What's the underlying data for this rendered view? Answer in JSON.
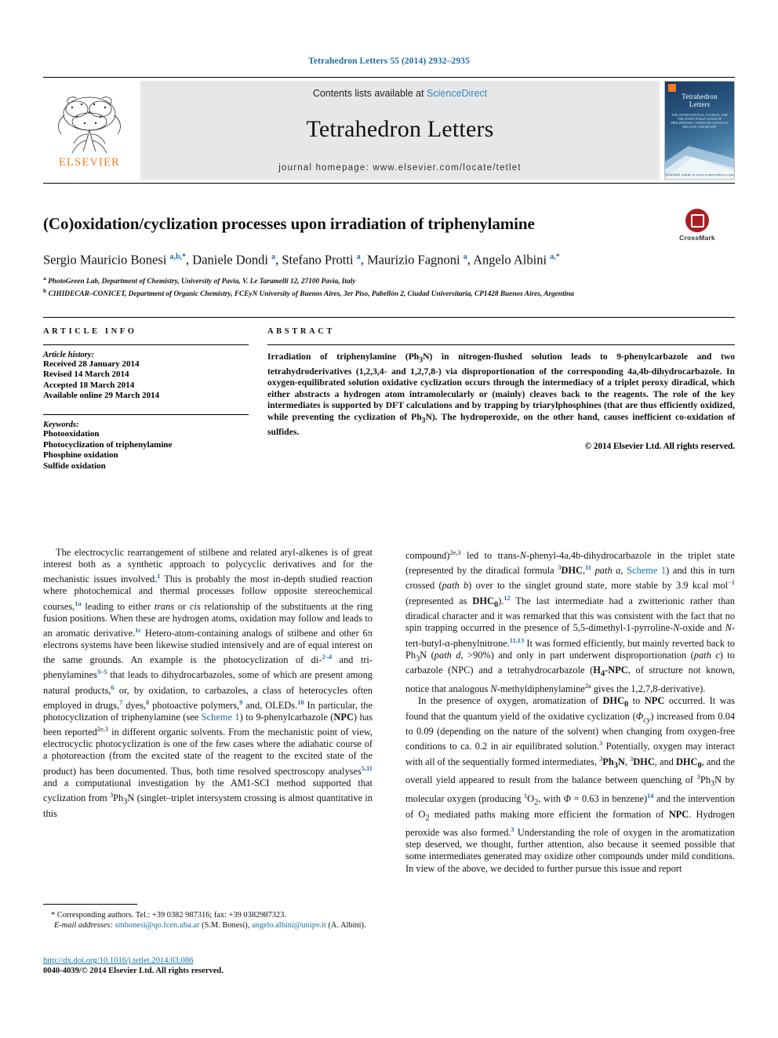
{
  "running_head": "Tetrahedron Letters 55 (2014) 2932–2935",
  "masthead": {
    "contents_prefix": "Contents lists available at ",
    "sciencedirect": "ScienceDirect",
    "journal_name": "Tetrahedron Letters",
    "homepage": "journal homepage: www.elsevier.com/locate/tetlet",
    "publisher": "ELSEVIER",
    "cover": {
      "title_line1": "Tetrahedron",
      "title_line2": "Letters",
      "subtitle": "THE INTERNATIONAL JOURNAL FOR THE RAPID PUBLICATION OF PRELIMINARY COMMUNICATIONS IN ORGANIC CHEMISTRY",
      "footer": "Available online at www.sciencedirect.com"
    }
  },
  "article": {
    "title": "(Co)oxidation/cyclization processes upon irradiation of triphenylamine",
    "crossmark_label": "CrossMark",
    "authors_html": "Sergio Mauricio Bonesi <sup>a,b,</sup><sup>*</sup>, Daniele Dondi <sup>a</sup>, Stefano Protti <sup>a</sup>, Maurizio Fagnoni <sup>a</sup>, Angelo Albini <sup>a,</sup><sup>*</sup>",
    "affiliation_a": "PhotoGreen Lab, Department of Chemistry, University of Pavia, V. Le Taramelli 12, 27100 Pavia, Italy",
    "affiliation_b": "CIHIDECAR–CONICET, Department of Organic Chemistry, FCEyN University of Buenos Aires, 3er Piso, Pabellón 2, Ciudad Universitaria, CP1428 Buenos Aires, Argentina"
  },
  "article_info": {
    "heading": "ARTICLE INFO",
    "history_title": "Article history:",
    "history": [
      "Received 28 January 2014",
      "Revised 14 March 2014",
      "Accepted 18 March 2014",
      "Available online 29 March 2014"
    ],
    "keywords_title": "Keywords:",
    "keywords": [
      "Photooxidation",
      "Photocyclization of triphenylamine",
      "Phosphine oxidation",
      "Sulfide oxidation"
    ]
  },
  "abstract": {
    "heading": "ABSTRACT",
    "text_html": "Irradiation of triphenylamine (Ph<sub>3</sub>N) in nitrogen-flushed solution leads to 9-phenylcarbazole and two tetrahydroderivatives (1,2,3,4- and 1,2,7,8-) via disproportionation of the corresponding 4a,4b-dihydrocarbazole. In oxygen-equilibrated solution oxidative cyclization occurs through the intermediacy of a triplet peroxy diradical, which either abstracts a hydrogen atom intramolecularly or (mainly) cleaves back to the reagents. The role of the key intermediates is supported by DFT calculations and by trapping by triarylphosphines (that are thus efficiently oxidized, while preventing the cyclization of Ph<sub>3</sub>N). The hydroperoxide, on the other hand, causes inefficient co-oxidation of sulfides.",
    "copyright": "© 2014 Elsevier Ltd. All rights reserved."
  },
  "body": {
    "left_paragraph_html": "The electrocyclic rearrangement of stilbene and related aryl-alkenes is of great interest both as a synthetic approach to polycyclic derivatives and for the mechanistic issues involved.<sup class=\"ref\">1</sup> This is probably the most in-depth studied reaction where photochemical and thermal processes follow opposite stereochemical courses,<sup class=\"ref\">1a</sup> leading to either <i>trans</i> or <i>cis</i> relationship of the substituents at the ring fusion positions. When these are hydrogen atoms, oxidation may follow and leads to an aromatic derivative.<sup class=\"ref\">1c</sup> Hetero-atom-containing analogs of stilbene and other 6π electrons systems have been likewise studied intensively and are of equal interest on the same grounds. An example is the photocyclization of di-<sup class=\"ref\">2–4</sup> and tri-phenylamines<sup class=\"ref\">3–5</sup> that leads to dihydrocarbazoles, some of which are present among natural products,<sup class=\"ref\">6</sup> or, by oxidation, to carbazoles, a class of heterocycles often employed in drugs,<sup class=\"ref\">7</sup> dyes,<sup class=\"ref\">8</sup> photoactive polymers,<sup class=\"ref\">9</sup> and, OLEDs.<sup class=\"ref\">10</sup> In particular, the photocyclization of triphenylamine (see <span class=\"lnk\">Scheme 1</span>) to 9-phenylcarbazole (<b>NPC</b>) has been reported<sup>2e,3</sup> in different organic solvents. From the mechanistic point of view, electrocyclic photocyclization is one of the few cases where the adiabatic course of a photoreaction (from the excited state of the reagent to the excited state of the product) has been documented. Thus, both time resolved spectroscopy analyses<sup class=\"ref\">5,11</sup> and a computational investigation by the AM1-SCI method supported that cyclization from <sup>3</sup>Ph<sub>3</sub>N (singlet–triplet intersystem crossing is almost quantitative in this",
    "right_paragraph_1_html": "compound)<sup>2e,3</sup> led to trans-<i>N</i>-phenyl-4a,4b-dihydrocarbazole in the triplet state (represented by the diradical formula <sup>3</sup><b>DHC</b>,<sup class=\"ref\">11</sup> <i>path a</i>, <span class=\"lnk\">Scheme 1</span>) and this in turn crossed (<i>path b</i>) over to the singlet ground state, more stable by 3.9 kcal mol<sup>−1</sup> (represented as <b>DHC<sub>0</sub></b>).<sup class=\"ref\">12</sup> The last intermediate had a zwitterionic rather than diradical character and it was remarked that this was consistent with the fact that no spin trapping occurred in the presence of 5,5-dimethyl-1-pyrroline-<i>N</i>-oxide and <i>N</i>-tert-butyl-α-phenylnitrone.<sup class=\"ref\">11,13</sup> It was formed efficiently, but mainly reverted back to Ph<sub>3</sub>N (<i>path d</i>, >90%) and only in part underwent disproportionation (<i>path c</i>) to carbazole (NPC) and a tetrahydrocarbazole (<b>H<sub>4</sub>-NPC</b>, of structure not known, notice that analogous <i>N</i>-methyldiphenylamine<sup>2a</sup> gives the 1,2,7,8-derivative).",
    "right_paragraph_2_html": "In the presence of oxygen, aromatization of <b>DHC<sub>0</sub></b> to <b>NPC</b> occurred. It was found that the quantum yield of the oxidative cyclization (<i>Φ<sub>cy</sub></i>) increased from 0.04 to 0.09 (depending on the nature of the solvent) when changing from oxygen-free conditions to ca. 0.2 in air equilibrated solution.<sup class=\"ref\">3</sup> Potentially, oxygen may interact with all of the sequentially formed intermediates, <sup>3</sup><b>Ph<sub>3</sub>N</b>, <sup>3</sup><b>DHC</b>, and <b>DHC<sub>0</sub></b>, and the overall yield appeared to result from the balance between quenching of <sup>3</sup>Ph<sub>3</sub>N by molecular oxygen (producing <sup>1</sup>O<sub>2</sub>, with <i>Φ</i> = 0.63 in benzene)<sup class=\"ref\">14</sup> and the intervention of O<sub>2</sub> mediated paths making more efficient the formation of <b>NPC</b>. Hydrogen peroxide was also formed.<sup class=\"ref\">3</sup> Understanding the role of oxygen in the aromatization step deserved, we thought, further attention, also because it seemed possible that some intermediates generated may oxidize other compounds under mild conditions. In view of the above, we decided to further pursue this issue and report"
  },
  "footnotes": {
    "corresponding_html": "* Corresponding authors. Tel.: +39 0382 987316; fax: +39 0382987323.",
    "emails_html": "<i>E-mail addresses:</i> <a>smbonesi@qo.fcen.uba.ar</a> (S.M. Bonesi), <a>angelo.albini@unipv.it</a> (A. Albini).",
    "doi": "http://dx.doi.org/10.1016/j.tetlet.2014.03.086",
    "issn": "0040-4039/© 2014 Elsevier Ltd. All rights reserved."
  },
  "colors": {
    "link_blue": "#1a6ea8",
    "sciencedirect_blue": "#2e8bc7",
    "elsevier_orange": "#F47B20",
    "crossmark_red": "#a81f24"
  }
}
